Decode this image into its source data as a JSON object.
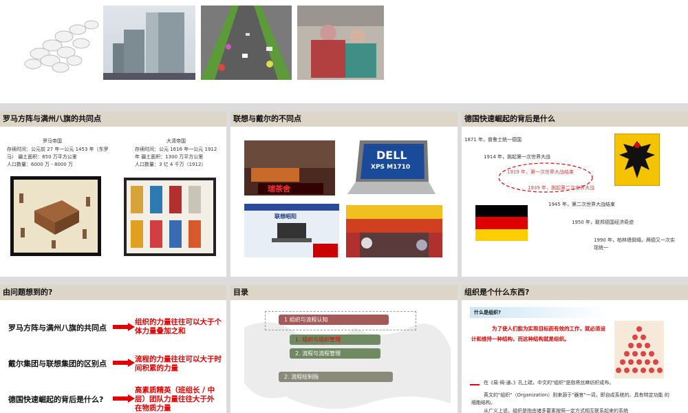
{
  "top_strip": {
    "images": [
      "pills-image",
      "silo-tanks-image",
      "highway-traffic-image",
      "workers-photo-image"
    ]
  },
  "slide1": {
    "title": "罗马方阵与满州八旗的共同点",
    "left": {
      "name": "罗马帝国",
      "line1": "存续时间：公元前 27 年一公元 1453 年（东罗",
      "line2": "马）  疆土面积：650 万平方公里",
      "line3": "人口数量：6000 万 - 8000 万"
    },
    "right": {
      "name": "大清帝国",
      "line1": "存续时间：公元 1616 年一公元 1912",
      "line2": "年 疆土面积：1300 万平方公里",
      "line3": "人口数量：3 亿 4 千万（1912）"
    }
  },
  "slide2": {
    "title": "联想与戴尔的不同点",
    "dell_brand": "DELL",
    "dell_model": "XPS M1710",
    "store_sign": "联想昭阳",
    "red_sign": "瑞茶舍"
  },
  "slide3": {
    "title": "德国快速崛起的背后是什么",
    "events": [
      "1871 年，普鲁士统一德国",
      "1914 年，挑起第一次世界大战",
      "1919 年，第一次世界大战结束",
      "1939 年，挑起第二次世界大战",
      "1945 年，第二次世界大战结束",
      "1950 年，联邦德国经济奇迹",
      "1990 年，柏林墙倒塌，两德又一次实现统一"
    ]
  },
  "slide4": {
    "title": "由问题想到的?",
    "rows": [
      {
        "q": "罗马方阵与满州八旗的共同点",
        "a": "组织的力量往往可以大于个体力量叠加之和"
      },
      {
        "q": "戴尔集团与联想集团的区别点",
        "a": "流程的力量往往可以大于时间积累的力量"
      },
      {
        "q": "德国快速崛起的背后是什么?",
        "a": "高素质精英（班组长 / 中层）团队力量往往大于外在物质力量"
      }
    ]
  },
  "slide5": {
    "title": "目录",
    "items": [
      "1 组织与流程认知",
      "1.  组织与组织管理",
      "2.  流程与流程管理",
      "2. 流程绘制指"
    ]
  },
  "slide6": {
    "title": "组织是个什么东西?",
    "subtitle": "什么是组织?",
    "definition": "为了使人们能为实现目标而有效的工作，就必须设计和维持一种结构，而这种结构就是组织。",
    "p1": "在《易·阀·通、》孔上疏，中文的\"组织\"是指将丝麻纺织成布。",
    "p2": "英文的\"组织\"（Organization）则来源于\"器官\"一词，即自成系统的、具有特定功能 的细胞结构。",
    "p3": "从广义上说，组织是指由诸多要素按照一定方式相互联系起来的系统"
  },
  "colors": {
    "header_bg": "#ddd6c8",
    "accent_red": "#e00000",
    "toc_box": "#a45a5a",
    "toc_green": "#6f8a62",
    "toc_gray": "#8a8a7a"
  }
}
